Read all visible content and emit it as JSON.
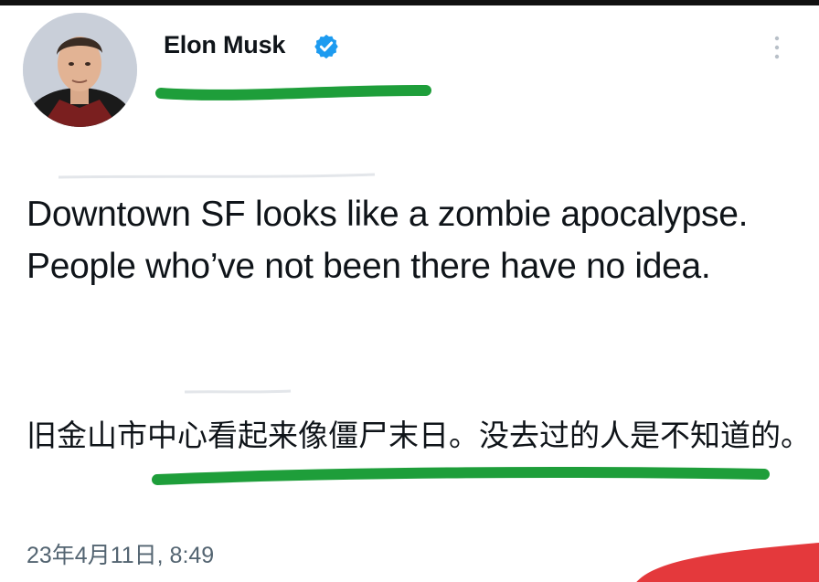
{
  "tweet": {
    "author": {
      "name": "Elon Musk",
      "verified_icon": "verified-badge-icon",
      "avatar": "profile-photo"
    },
    "more_icon": "vertical-dots-icon",
    "text": "Downtown SF looks like a zombie apocalypse. People who’ve not been there have no idea.",
    "translation": "旧金山市中心看起来像僵尸末日。没去过的人是不知道的。",
    "timestamp": "23年4月11日, 8:49"
  },
  "annotations": {
    "underline_color": "#1e9e3a",
    "corner_mark_color": "#e4393c"
  },
  "colors": {
    "text": "#0f1419",
    "secondary_text": "#536471",
    "verified": "#1d9bf0"
  }
}
